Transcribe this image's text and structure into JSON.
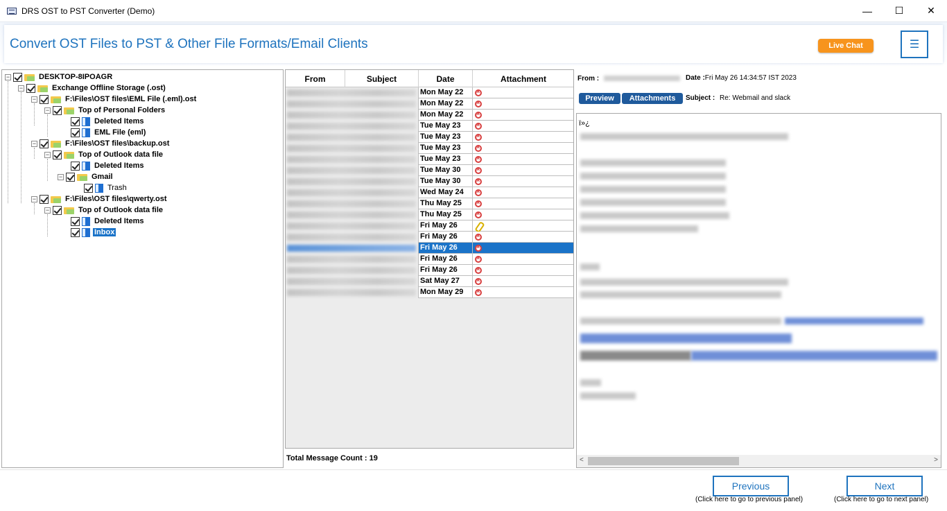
{
  "window": {
    "title": "DRS OST to PST Converter (Demo)",
    "minimize": "—",
    "maximize": "☐",
    "close": "✕"
  },
  "header": {
    "title": "Convert OST Files to PST & Other File Formats/Email Clients",
    "live_chat": "Live Chat",
    "menu_icon": "☰"
  },
  "tree": {
    "items": [
      {
        "label": "DESKTOP-8IPOAGR"
      },
      {
        "label": "Exchange Offline Storage (.ost)"
      },
      {
        "label": "F:\\Files\\OST files\\EML File (.eml).ost"
      },
      {
        "label": "Top of Personal Folders"
      },
      {
        "label": "Deleted Items"
      },
      {
        "label": "EML File (eml)"
      },
      {
        "label": "F:\\Files\\OST files\\backup.ost"
      },
      {
        "label": "Top of Outlook data file"
      },
      {
        "label": "Deleted Items"
      },
      {
        "label": "Gmail"
      },
      {
        "label": "Trash"
      },
      {
        "label": "F:\\Files\\OST files\\qwerty.ost"
      },
      {
        "label": "Top of Outlook data file"
      },
      {
        "label": "Deleted Items"
      },
      {
        "label": "Inbox"
      }
    ]
  },
  "list": {
    "columns": [
      "From",
      "Subject",
      "Date",
      "Attachment"
    ],
    "rows": [
      {
        "date": "Mon May 22",
        "attachment": "none"
      },
      {
        "date": "Mon May 22",
        "attachment": "none"
      },
      {
        "date": "Mon May 22",
        "attachment": "none"
      },
      {
        "date": "Tue May 23",
        "attachment": "none"
      },
      {
        "date": "Tue May 23",
        "attachment": "none"
      },
      {
        "date": "Tue May 23",
        "attachment": "none"
      },
      {
        "date": "Tue May 23",
        "attachment": "none"
      },
      {
        "date": "Tue May 30",
        "attachment": "none"
      },
      {
        "date": "Tue May 30",
        "attachment": "none"
      },
      {
        "date": "Wed May 24",
        "attachment": "none"
      },
      {
        "date": "Thu May 25",
        "attachment": "none"
      },
      {
        "date": "Thu May 25",
        "attachment": "none"
      },
      {
        "date": "Fri May 26",
        "attachment": "clip"
      },
      {
        "date": "Fri May 26",
        "attachment": "none"
      },
      {
        "date": "Fri May 26",
        "attachment": "none"
      },
      {
        "date": "Fri May 26",
        "attachment": "none"
      },
      {
        "date": "Fri May 26",
        "attachment": "none"
      },
      {
        "date": "Sat May 27",
        "attachment": "none"
      },
      {
        "date": "Mon May 29",
        "attachment": "none"
      }
    ],
    "total_label": "Total Message Count : 19"
  },
  "preview": {
    "from_label": "From :",
    "date_label": "Date :",
    "date_value": "Fri May 26 14:34:57 IST 2023",
    "preview_tab": "Preview",
    "attachments_tab": "Attachments",
    "subject_label": "Subject :",
    "subject_value": "Re: Webmail and slack",
    "body_start": "ï»¿"
  },
  "footer": {
    "previous": "Previous",
    "previous_hint": "(Click here to go to previous panel)",
    "next": "Next",
    "next_hint": "(Click here to go to next panel)"
  }
}
